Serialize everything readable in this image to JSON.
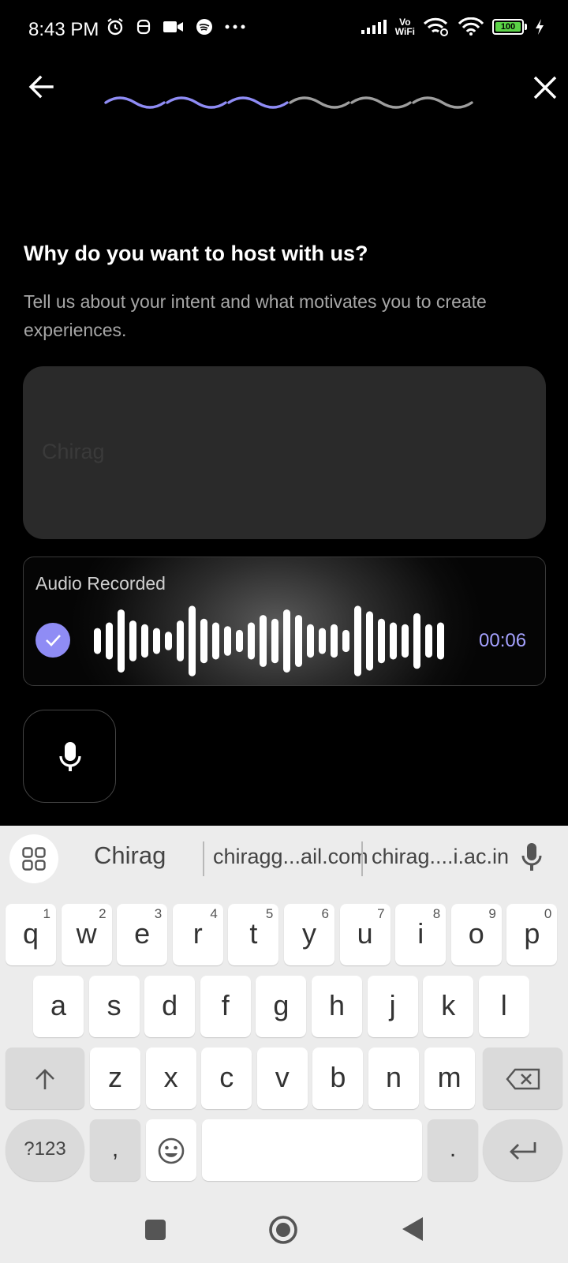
{
  "status_bar": {
    "time": "8:43 PM",
    "network_label_top": "Vo",
    "network_label_bottom": "WiFi",
    "battery_level": "100",
    "icons": [
      "alarm-icon",
      "face-icon",
      "video-icon",
      "app-icon",
      "more-dots-icon",
      "signal-icon",
      "wifi-link-icon",
      "wifi-icon",
      "battery-icon",
      "charging-icon"
    ]
  },
  "header": {
    "back_icon": "arrow-left-icon",
    "close_icon": "close-icon",
    "progress": {
      "completed_steps": 3,
      "total_steps": 6,
      "active_color": "#8f8cf5",
      "inactive_color": "#9e9e9e"
    }
  },
  "content": {
    "question": "Why do you want to host with us?",
    "helper_text": "Tell us about your intent and what motivates you to create experiences.",
    "text_input": {
      "placeholder": "Chirag"
    }
  },
  "audio": {
    "label": "Audio Recorded",
    "duration": "00:06",
    "accent": "#8f8cf5",
    "bar_levels": [
      0.35,
      0.5,
      0.85,
      0.55,
      0.45,
      0.35,
      0.25,
      0.55,
      0.95,
      0.6,
      0.5,
      0.4,
      0.3,
      0.5,
      0.7,
      0.6,
      0.85,
      0.7,
      0.45,
      0.35,
      0.45,
      0.3,
      0.95,
      0.8,
      0.6,
      0.5,
      0.45,
      0.75,
      0.45,
      0.5
    ]
  },
  "mic_button": {
    "icon": "microphone-icon"
  },
  "keyboard": {
    "suggestions": [
      "Chirag",
      "chiragg...ail.com",
      "chirag....i.ac.in"
    ],
    "row1": [
      {
        "k": "q",
        "h": "1"
      },
      {
        "k": "w",
        "h": "2"
      },
      {
        "k": "e",
        "h": "3"
      },
      {
        "k": "r",
        "h": "4"
      },
      {
        "k": "t",
        "h": "5"
      },
      {
        "k": "y",
        "h": "6"
      },
      {
        "k": "u",
        "h": "7"
      },
      {
        "k": "i",
        "h": "8"
      },
      {
        "k": "o",
        "h": "9"
      },
      {
        "k": "p",
        "h": "0"
      }
    ],
    "row2": [
      "a",
      "s",
      "d",
      "f",
      "g",
      "h",
      "j",
      "k",
      "l"
    ],
    "row3": [
      "z",
      "x",
      "c",
      "v",
      "b",
      "n",
      "m"
    ],
    "symbols_label": "?123",
    "comma": ",",
    "period": "."
  },
  "nav_bar": {
    "icons": [
      "recents-icon",
      "home-icon",
      "back-icon"
    ]
  }
}
